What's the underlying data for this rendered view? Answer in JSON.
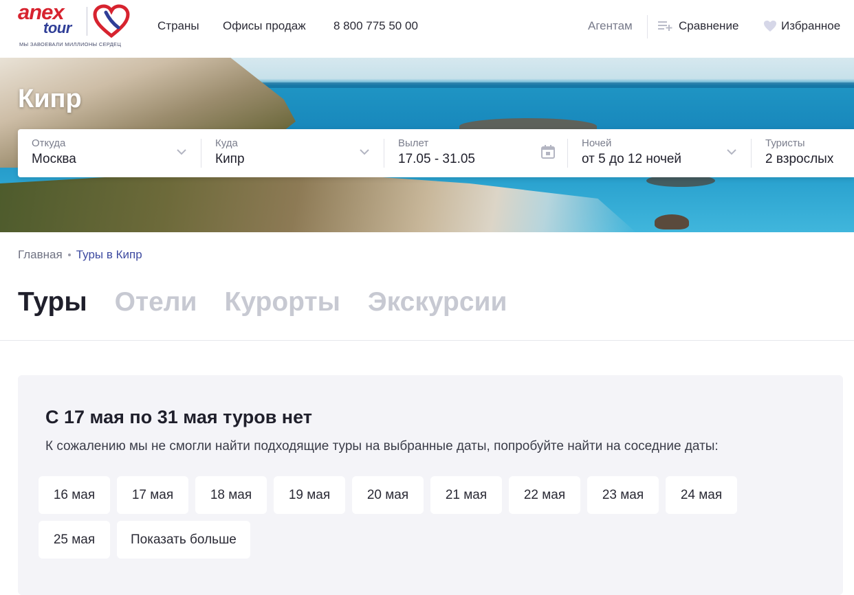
{
  "header": {
    "logo": {
      "word1": "anex",
      "word2": "tour",
      "slogan": "МЫ ЗАВОЕВАЛИ МИЛЛИОНЫ СЕРДЕЦ"
    },
    "nav": {
      "countries": "Страны",
      "offices": "Офисы продаж",
      "phone": "8 800 775 50 00"
    },
    "agents": "Агентам",
    "compare": "Сравнение",
    "favorites": "Избранное",
    "colors": {
      "brand_red": "#d7232f",
      "brand_blue": "#2f3e97"
    }
  },
  "hero": {
    "title": "Кипр"
  },
  "search": {
    "from": {
      "label": "Откуда",
      "value": "Москва",
      "icon": "chevron-down-icon"
    },
    "to": {
      "label": "Куда",
      "value": "Кипр",
      "icon": "chevron-down-icon"
    },
    "departure": {
      "label": "Вылет",
      "value": "17.05 - 31.05",
      "icon": "calendar-icon"
    },
    "nights": {
      "label": "Ночей",
      "value": "от 5 до 12 ночей",
      "icon": "chevron-down-icon"
    },
    "tourists": {
      "label": "Туристы",
      "value": "2 взрослых"
    }
  },
  "breadcrumbs": {
    "home": "Главная",
    "current": "Туры в Кипр"
  },
  "tabs": [
    {
      "label": "Туры",
      "active": true
    },
    {
      "label": "Отели",
      "active": false
    },
    {
      "label": "Курорты",
      "active": false
    },
    {
      "label": "Экскурсии",
      "active": false
    }
  ],
  "no_results": {
    "title": "С 17 мая по 31 мая туров нет",
    "message": "К сожалению мы не смогли найти подходящие туры на выбранные даты, попробуйте найти на соседние даты:",
    "dates": [
      "16 мая",
      "17 мая",
      "18 мая",
      "19 мая",
      "20 мая",
      "21 мая",
      "22 мая",
      "23 мая",
      "24 мая",
      "25 мая"
    ],
    "show_more": "Показать больше"
  }
}
